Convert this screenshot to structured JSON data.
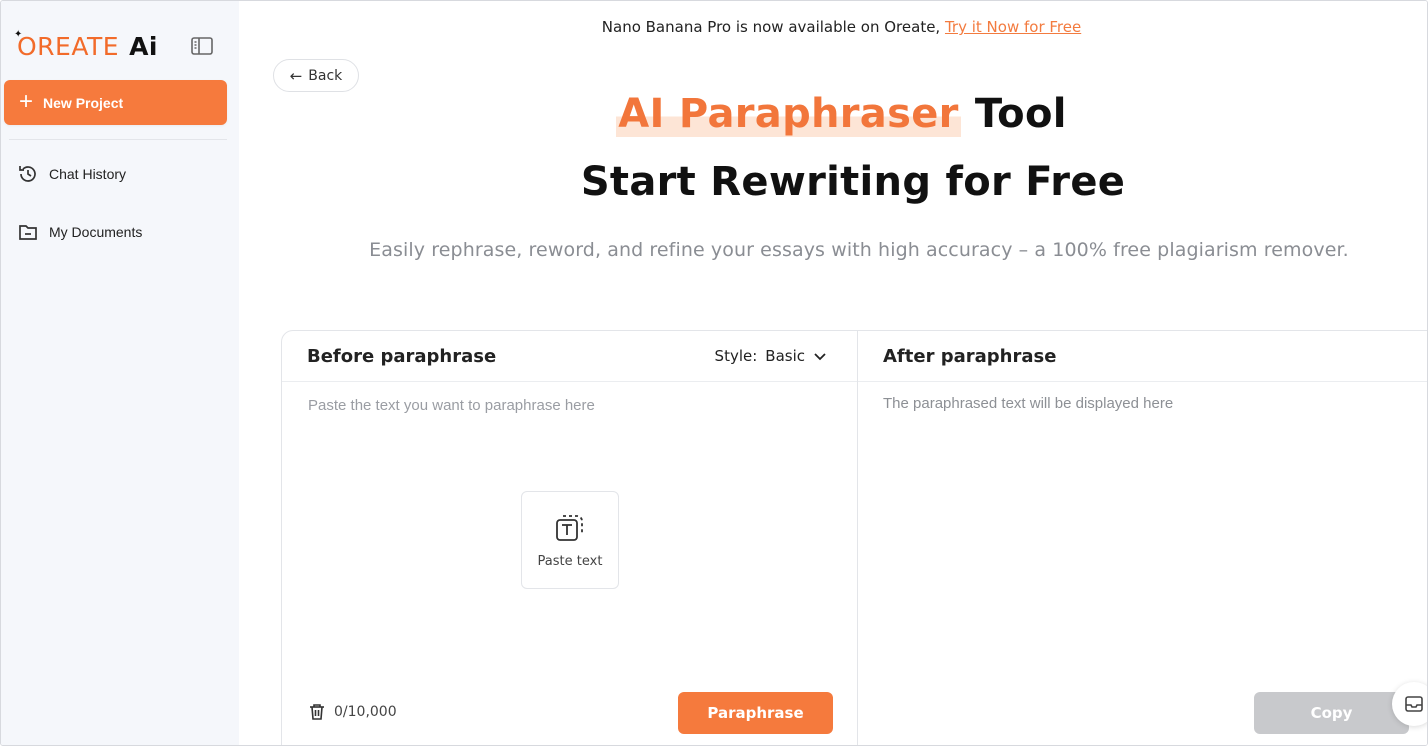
{
  "sidebar": {
    "logo_brand": "OREATE",
    "logo_ai": "Ai",
    "new_project_label": "New Project",
    "items": [
      {
        "label": "Chat History",
        "icon": "history-icon"
      },
      {
        "label": "My Documents",
        "icon": "folder-icon"
      }
    ]
  },
  "banner": {
    "text": "Nano Banana Pro is now available on Oreate, ",
    "link": "Try it Now for Free"
  },
  "back_label": "Back",
  "hero": {
    "title_highlight": "AI Paraphraser",
    "title_rest": " Tool",
    "subtitle": "Start Rewriting for Free",
    "description": "Easily rephrase, reword, and refine your essays with high accuracy – a 100% free plagiarism remover."
  },
  "editor": {
    "before_title": "Before paraphrase",
    "style_label": "Style:",
    "style_value": "Basic",
    "input_placeholder": "Paste the text you want to paraphrase here",
    "paste_label": "Paste text",
    "counter": "0/10,000",
    "paraphrase_label": "Paraphrase",
    "after_title": "After paraphrase",
    "output_placeholder": "The paraphrased text will be displayed here",
    "copy_label": "Copy"
  },
  "colors": {
    "accent": "#f57a3d",
    "sidebar_bg": "#f5f7fb",
    "copy_disabled": "#c8c9cc"
  }
}
